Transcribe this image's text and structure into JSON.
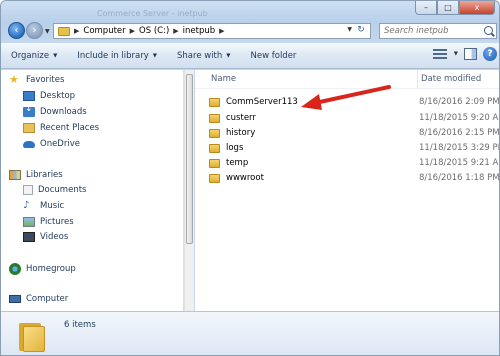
{
  "title_hint": "Commerce Server - inetpub",
  "window_controls": {
    "minimize": "–",
    "maximize": "□",
    "close": "x"
  },
  "address": {
    "crumbs": [
      "Computer",
      "OS (C:)",
      "inetpub"
    ]
  },
  "search": {
    "placeholder": "Search inetpub"
  },
  "toolbar": {
    "organize": "Organize",
    "include_in_library": "Include in library",
    "share_with": "Share with",
    "new_folder": "New folder",
    "help": "?"
  },
  "nav": {
    "favorites": "Favorites",
    "desktop": "Desktop",
    "downloads": "Downloads",
    "recent_places": "Recent Places",
    "onedrive": "OneDrive",
    "libraries": "Libraries",
    "documents": "Documents",
    "music": "Music",
    "pictures": "Pictures",
    "videos": "Videos",
    "homegroup": "Homegroup",
    "computer": "Computer"
  },
  "columns": {
    "name": "Name",
    "date_modified": "Date modified"
  },
  "files": [
    {
      "name": "CommServer113",
      "date": "8/16/2016 2:09 PM"
    },
    {
      "name": "custerr",
      "date": "11/18/2015 9:20 AM"
    },
    {
      "name": "history",
      "date": "8/16/2016 2:15 PM"
    },
    {
      "name": "logs",
      "date": "11/18/2015 3:29 PM"
    },
    {
      "name": "temp",
      "date": "11/18/2015 9:21 AM"
    },
    {
      "name": "wwwroot",
      "date": "8/16/2016 1:18 PM"
    }
  ],
  "status": {
    "item_count": "6 items"
  },
  "colors": {
    "accent": "#1e395b",
    "arrow": "#d9261c",
    "folder": "#e8c14a"
  }
}
